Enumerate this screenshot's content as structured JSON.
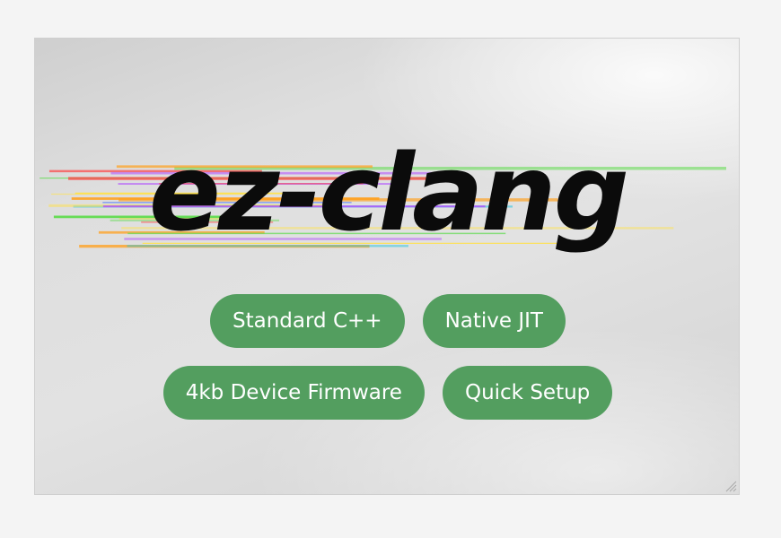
{
  "logo": {
    "text": "ez-clang",
    "streak_colors": [
      "#ff3b3b",
      "#ff9f1c",
      "#ffe14d",
      "#5cdb4a",
      "#24c4e0",
      "#3a6bff",
      "#b04cff",
      "#ff4fd8"
    ]
  },
  "buttons": {
    "standard_cpp": "Standard C++",
    "native_jit": "Native JIT",
    "device_firmware": "4kb Device Firmware",
    "quick_setup": "Quick Setup"
  },
  "colors": {
    "button_bg": "#539e5f",
    "button_text": "#ffffff"
  },
  "icons": {
    "resize": "resize-grip-icon"
  }
}
